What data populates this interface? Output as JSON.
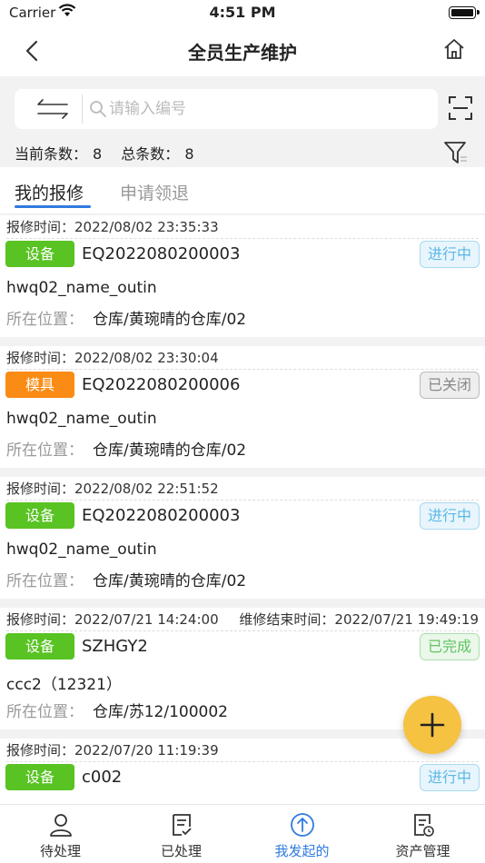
{
  "status_bar": {
    "carrier": "Carrier",
    "time": "4:51 PM"
  },
  "nav": {
    "title": "全员生产维护"
  },
  "search": {
    "placeholder": "请输入编号",
    "value": ""
  },
  "counts": {
    "current_label": "当前条数：",
    "current_value": "8",
    "total_label": "总条数：",
    "total_value": "8"
  },
  "tabs": [
    {
      "label": "我的报修"
    },
    {
      "label": "申请领退"
    }
  ],
  "labels": {
    "report_time": "报修时间：",
    "end_time": "维修结束时间：",
    "location": "所在位置："
  },
  "colors": {
    "tag_equipment": "#58c322",
    "tag_mold": "#fa8c16",
    "accent": "#2f7be0",
    "fab": "#f5c242"
  },
  "records": [
    {
      "report_time": "2022/08/02 23:35:33",
      "tag": "设备",
      "code": "EQ2022080200003",
      "status": "进行中",
      "name": "hwq02_name_outin",
      "location": "仓库/黄琬晴的仓库/02"
    },
    {
      "report_time": "2022/08/02 23:30:04",
      "tag": "模具",
      "code": "EQ2022080200006",
      "status": "已关闭",
      "name": "hwq02_name_outin",
      "location": "仓库/黄琬晴的仓库/02"
    },
    {
      "report_time": "2022/08/02 22:51:52",
      "tag": "设备",
      "code": "EQ2022080200003",
      "status": "进行中",
      "name": "hwq02_name_outin",
      "location": "仓库/黄琬晴的仓库/02"
    },
    {
      "report_time": "2022/07/21 14:24:00",
      "end_time": "2022/07/21 19:49:19",
      "tag": "设备",
      "code": "SZHGY2",
      "status": "已完成",
      "name": "ccc2（12321）",
      "location": "仓库/苏12/100002"
    },
    {
      "report_time": "2022/07/20 11:19:39",
      "tag": "设备",
      "code": "c002",
      "status": "进行中",
      "name": "",
      "location": ""
    }
  ],
  "tabbar": [
    {
      "label": "待处理",
      "icon": "person-icon"
    },
    {
      "label": "已处理",
      "icon": "checklist-icon"
    },
    {
      "label": "我发起的",
      "icon": "arrow-up-circle-icon"
    },
    {
      "label": "资产管理",
      "icon": "asset-doc-icon"
    }
  ]
}
